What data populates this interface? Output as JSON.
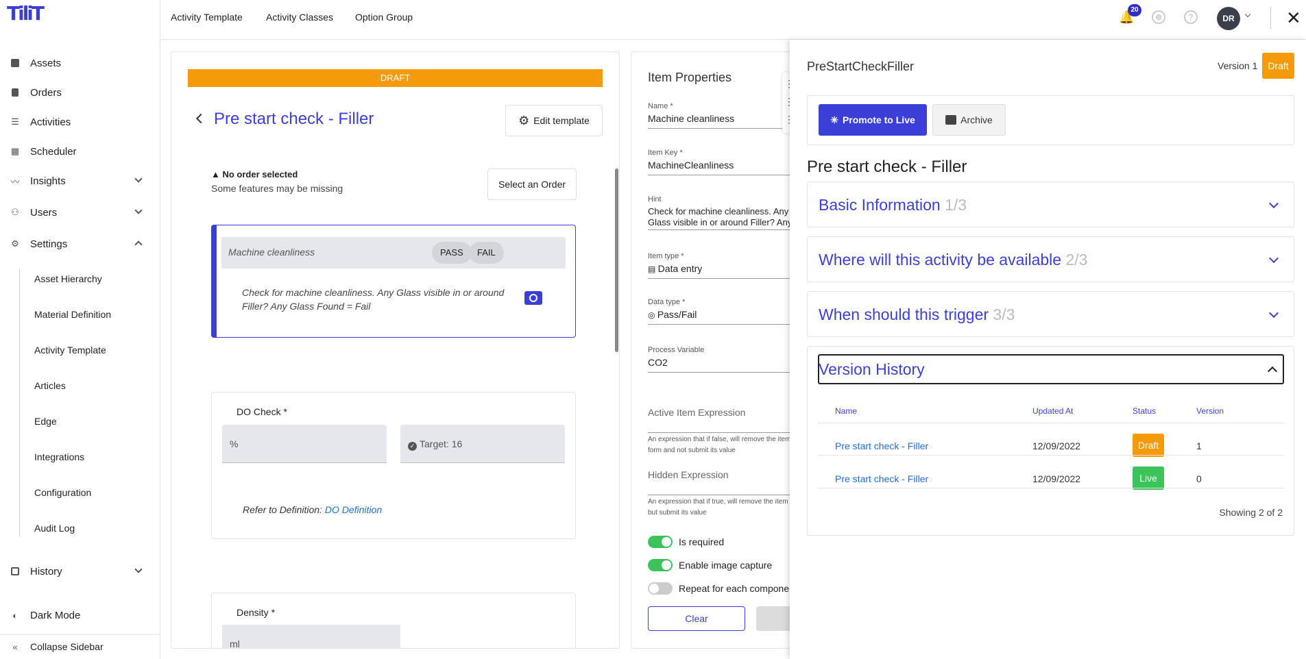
{
  "app": {
    "logo": "TiliT"
  },
  "sidebar": {
    "items": [
      {
        "label": "Assets",
        "icon": "assets-icon"
      },
      {
        "label": "Orders",
        "icon": "orders-icon"
      },
      {
        "label": "Activities",
        "icon": "activities-icon"
      },
      {
        "label": "Scheduler",
        "icon": "scheduler-icon"
      },
      {
        "label": "Insights",
        "icon": "insights-icon"
      },
      {
        "label": "Users",
        "icon": "users-icon"
      },
      {
        "label": "Settings",
        "icon": "gear-icon"
      }
    ],
    "settings_sub": [
      "Asset Hierarchy",
      "Material Definition",
      "Activity Template",
      "Articles",
      "Edge",
      "Integrations",
      "Configuration",
      "Audit Log"
    ],
    "history": "History",
    "dark_mode": "Dark Mode",
    "collapse": "Collapse Sidebar"
  },
  "topbar": {
    "links": [
      "Activity Template",
      "Activity Classes",
      "Option Group"
    ],
    "notification_count": "20",
    "avatar": "DR"
  },
  "template": {
    "banner": "DRAFT",
    "title": "Pre start check - Filler",
    "edit_button": "Edit template",
    "warning_title": "No order selected",
    "warning_sub": "Some features may be missing",
    "select_order": "Select an Order",
    "item": {
      "label": "Machine cleanliness",
      "pass": "PASS",
      "fail": "FAIL",
      "hint": "Check for machine cleanliness. Any Glass visible in or around Filler? Any Glass Found = Fail"
    },
    "do_check": {
      "title": "DO Check *",
      "unit": "%",
      "target": "Target: 16",
      "refer_prefix": "Refer to Definition: ",
      "refer_link": "DO Definition"
    },
    "density": {
      "title": "Density *",
      "unit": "ml"
    }
  },
  "props": {
    "title": "Item Properties",
    "name_label": "Name *",
    "name_value": "Machine cleanliness",
    "key_label": "Item Key *",
    "key_value": "MachineCleanliness",
    "hint_label": "Hint",
    "hint_value": "Check for machine cleanliness. Any Glass visible in or around Filler? Any Glass",
    "type_label": "Item type *",
    "type_value": "Data entry",
    "data_label": "Data type *",
    "data_value": "Pass/Fail",
    "pv_label": "Process Variable",
    "pv_value": "CO2",
    "active_expr": "Active Item Expression",
    "active_desc_1": "An expression that if false, will remove the item from the",
    "active_desc_2": "form and not submit its value",
    "hidden_expr": "Hidden Expression",
    "hidden_desc_1": "An expression that if true, will remove the item from the form",
    "hidden_desc_2": "but submit its value",
    "toggle_required": "Is required",
    "toggle_image": "Enable image capture",
    "toggle_repeat": "Repeat for each component",
    "clear": "Clear"
  },
  "drawer": {
    "title": "PreStartCheckFiller",
    "version": "Version 1",
    "status": "Draft",
    "promote": "Promote to Live",
    "archive": "Archive",
    "heading": "Pre start check - Filler",
    "accordions": [
      {
        "title": "Basic Information",
        "step": "1/3"
      },
      {
        "title": "Where will this activity be available",
        "step": "2/3"
      },
      {
        "title": "When should this trigger",
        "step": "3/3"
      }
    ],
    "history_title": "Version History",
    "columns": [
      "Name",
      "Updated At",
      "Status",
      "Version"
    ],
    "rows": [
      {
        "name": "Pre start check - Filler",
        "updated": "12/09/2022",
        "status": "Draft",
        "version": "1"
      },
      {
        "name": "Pre start check - Filler",
        "updated": "12/09/2022",
        "status": "Live",
        "version": "0"
      }
    ],
    "showing": "Showing 2 of 2"
  },
  "colors": {
    "accent": "#3b3fd8",
    "draft": "#f59a0b",
    "live": "#3cc35a"
  }
}
